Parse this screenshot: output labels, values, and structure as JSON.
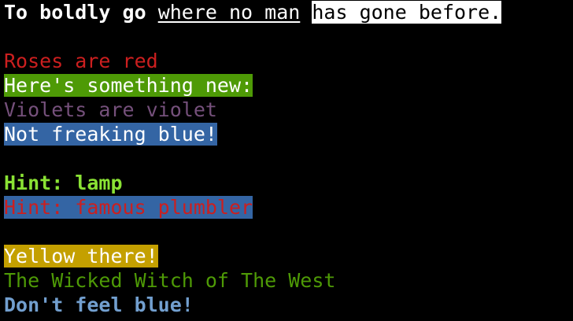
{
  "terminal": {
    "lines": [
      {
        "segments": [
          {
            "text": "To boldly go",
            "fg": "#ffffff",
            "bg": null,
            "bold": true,
            "underline": false
          },
          {
            "text": " ",
            "fg": "#ffffff",
            "bg": null,
            "bold": false,
            "underline": false
          },
          {
            "text": "where no man",
            "fg": "#ffffff",
            "bg": null,
            "bold": false,
            "underline": true
          },
          {
            "text": " ",
            "fg": "#ffffff",
            "bg": null,
            "bold": false,
            "underline": false
          },
          {
            "text": "has gone before.",
            "fg": "#000000",
            "bg": "#ffffff",
            "bold": false,
            "underline": false
          }
        ]
      },
      {
        "segments": []
      },
      {
        "segments": [
          {
            "text": "Roses are red",
            "fg": "#cc1f1f",
            "bg": null,
            "bold": false,
            "underline": false
          }
        ]
      },
      {
        "segments": [
          {
            "text": "Here's something new:",
            "fg": "#ffffff",
            "bg": "#4e9a06",
            "bold": false,
            "underline": false
          }
        ]
      },
      {
        "segments": [
          {
            "text": "Violets are violet",
            "fg": "#75507b",
            "bg": null,
            "bold": false,
            "underline": false
          }
        ]
      },
      {
        "segments": [
          {
            "text": "Not freaking blue!",
            "fg": "#ffffff",
            "bg": "#3465a4",
            "bold": false,
            "underline": false
          }
        ]
      },
      {
        "segments": []
      },
      {
        "segments": [
          {
            "text": "Hint: lamp",
            "fg": "#8ae234",
            "bg": null,
            "bold": true,
            "underline": false
          }
        ]
      },
      {
        "segments": [
          {
            "text": "Hint: famous plumbler",
            "fg": "#cc1f1f",
            "bg": "#3465a4",
            "bold": false,
            "underline": false
          }
        ]
      },
      {
        "segments": []
      },
      {
        "segments": [
          {
            "text": "Yellow there!",
            "fg": "#ffffff",
            "bg": "#c4a000",
            "bold": false,
            "underline": false
          }
        ]
      },
      {
        "segments": [
          {
            "text": "The Wicked Witch of The West",
            "fg": "#4e9a06",
            "bg": null,
            "bold": false,
            "underline": false
          }
        ]
      },
      {
        "segments": [
          {
            "text": "Don't feel blue!",
            "fg": "#729fcf",
            "bg": null,
            "bold": true,
            "underline": false
          }
        ]
      }
    ]
  }
}
